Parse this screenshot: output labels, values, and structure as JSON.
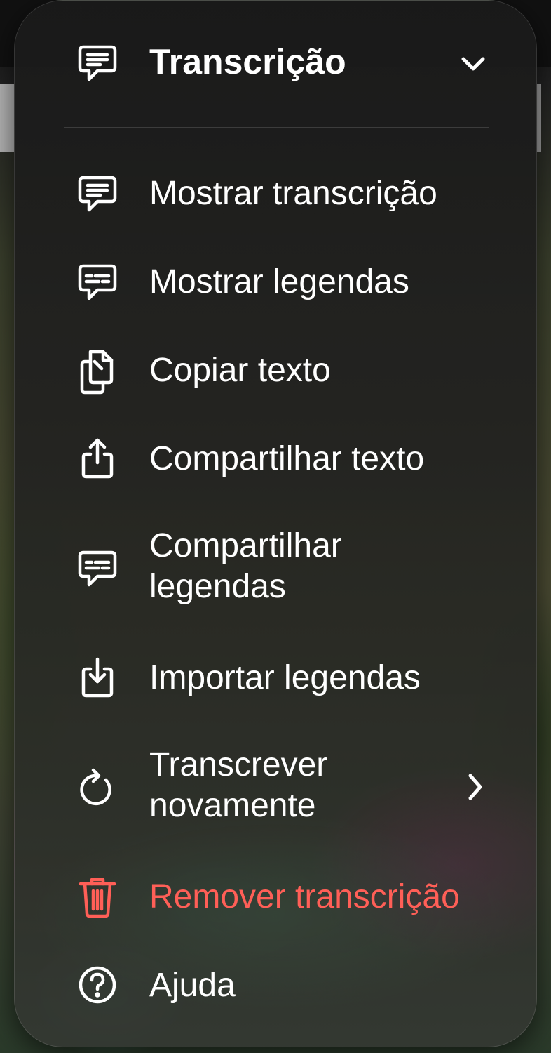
{
  "menu": {
    "title": "Transcrição",
    "title_icon": "speech-bubble-text-icon",
    "collapse_icon": "chevron-down-icon",
    "items": [
      {
        "label": "Mostrar transcrição",
        "icon": "speech-bubble-text-icon"
      },
      {
        "label": "Mostrar legendas",
        "icon": "captions-bubble-icon"
      },
      {
        "label": "Copiar texto",
        "icon": "copy-document-icon"
      },
      {
        "label": "Compartilhar texto",
        "icon": "share-icon"
      },
      {
        "label": "Compartilhar\nlegendas",
        "icon": "captions-bubble-icon"
      },
      {
        "label": "Importar legendas",
        "icon": "import-tray-icon"
      },
      {
        "label": "Transcrever\nnovamente",
        "icon": "refresh-icon",
        "trailing_icon": "chevron-right-icon"
      },
      {
        "label": "Remover transcrição",
        "icon": "trash-icon",
        "style": "destructive"
      },
      {
        "label": "Ajuda",
        "icon": "question-circle-icon"
      }
    ]
  },
  "colors": {
    "destructive": "#ff5f57",
    "text": "#ffffff"
  }
}
